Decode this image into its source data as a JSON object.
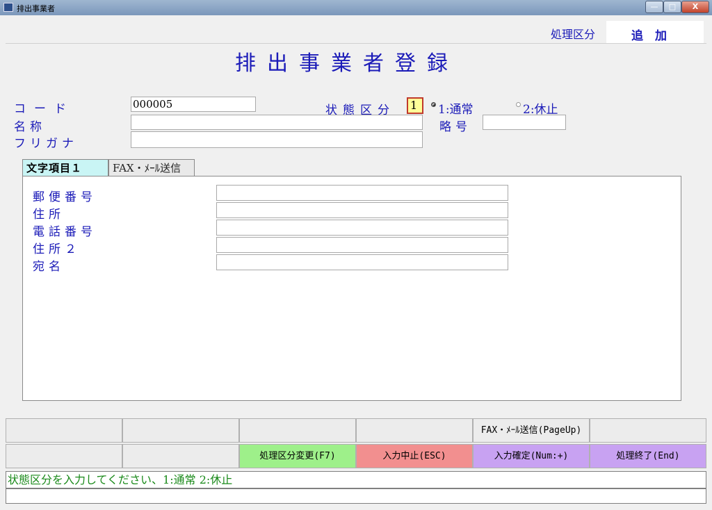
{
  "window": {
    "title": "排出事業者",
    "min": "—",
    "max": "□",
    "close": "X"
  },
  "header": {
    "mode_label": "処理区分",
    "mode_value": "追　加"
  },
  "form_title": "排出事業者登録",
  "fields": {
    "code_label": "コード",
    "code_value": "000005",
    "name_label": "名称",
    "kana_label": "フリガナ",
    "status_label": "状態区分",
    "status_value": "1",
    "radio1": "1:通常",
    "radio2": "2:休止",
    "abbr_label": "略号"
  },
  "tabs": [
    {
      "label": "文字項目１"
    },
    {
      "label": "FAX・ﾒｰﾙ送信"
    }
  ],
  "tab_fields": [
    {
      "label": "郵便番号"
    },
    {
      "label": "住所"
    },
    {
      "label": "電話番号"
    },
    {
      "label": "住所２"
    },
    {
      "label": "宛名"
    }
  ],
  "fkeys_row1": [
    "",
    "",
    "",
    "",
    "FAX・ﾒｰﾙ送信(PageUp)",
    ""
  ],
  "fkeys_row2": [
    "",
    "",
    "処理区分変更(F7)",
    "入力中止(ESC)",
    "入力確定(Num:+)",
    "処理終了(End)"
  ],
  "colors": {
    "green": "#9ef08a",
    "red": "#f28f8f",
    "purple": "#c8a2f2",
    "highlight": "#ffff99",
    "tab_active": "#c9f5f5"
  },
  "status_message": "状態区分を入力してください、1:通常 2:休止"
}
